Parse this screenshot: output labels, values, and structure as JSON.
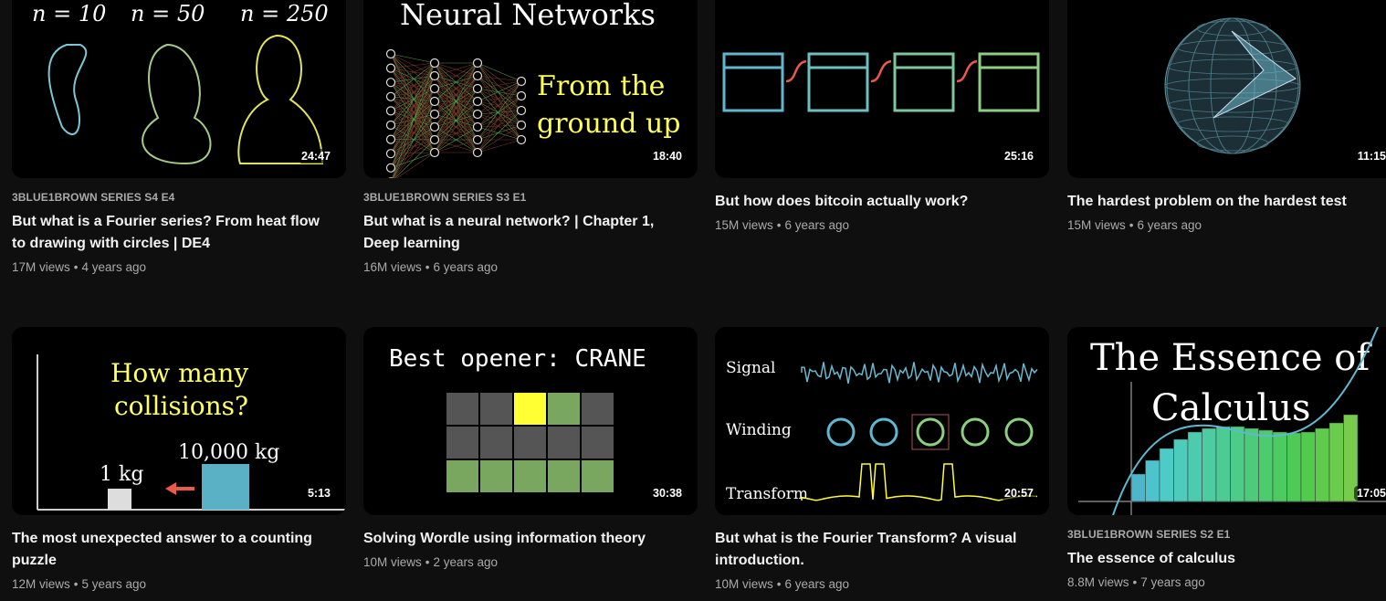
{
  "videos": [
    {
      "series": "3BLUE1BROWN SERIES  S4 E4",
      "title": "But what is a Fourier series? From heat flow to drawing with circles | DE4",
      "views": "17M views",
      "age": "4 years ago",
      "duration": "24:47",
      "thumb_text": [
        "n = 10",
        "n = 50",
        "n = 250"
      ]
    },
    {
      "series": "3BLUE1BROWN SERIES  S3 E1",
      "title": "But what is a neural network? | Chapter 1, Deep learning",
      "views": "16M views",
      "age": "6 years ago",
      "duration": "18:40",
      "thumb_text": [
        "Neural Networks",
        "From the",
        "ground up"
      ]
    },
    {
      "series": null,
      "title": "But how does bitcoin actually work?",
      "views": "15M views",
      "age": "6 years ago",
      "duration": "25:16",
      "thumb_text": []
    },
    {
      "series": null,
      "title": "The hardest problem on the hardest test",
      "views": "15M views",
      "age": "6 years ago",
      "duration": "11:15",
      "thumb_text": []
    },
    {
      "series": null,
      "title": "The most unexpected answer to a counting puzzle",
      "views": "12M views",
      "age": "5 years ago",
      "duration": "5:13",
      "thumb_text": [
        "How many",
        "collisions?",
        "1 kg",
        "10,000 kg"
      ]
    },
    {
      "series": null,
      "title": "Solving Wordle using information theory",
      "views": "10M views",
      "age": "2 years ago",
      "duration": "30:38",
      "thumb_text": [
        "Best opener: CRANE"
      ]
    },
    {
      "series": null,
      "title": "But what is the Fourier Transform? A visual introduction.",
      "views": "10M views",
      "age": "6 years ago",
      "duration": "20:57",
      "thumb_text": [
        "Signal",
        "Winding",
        "Transform"
      ]
    },
    {
      "series": "3BLUE1BROWN SERIES  S2 E1",
      "title": "The essence of calculus",
      "views": "8.8M views",
      "age": "7 years ago",
      "duration": "17:05",
      "thumb_text": [
        "The Essence of",
        "Calculus"
      ]
    }
  ],
  "separator": "•"
}
